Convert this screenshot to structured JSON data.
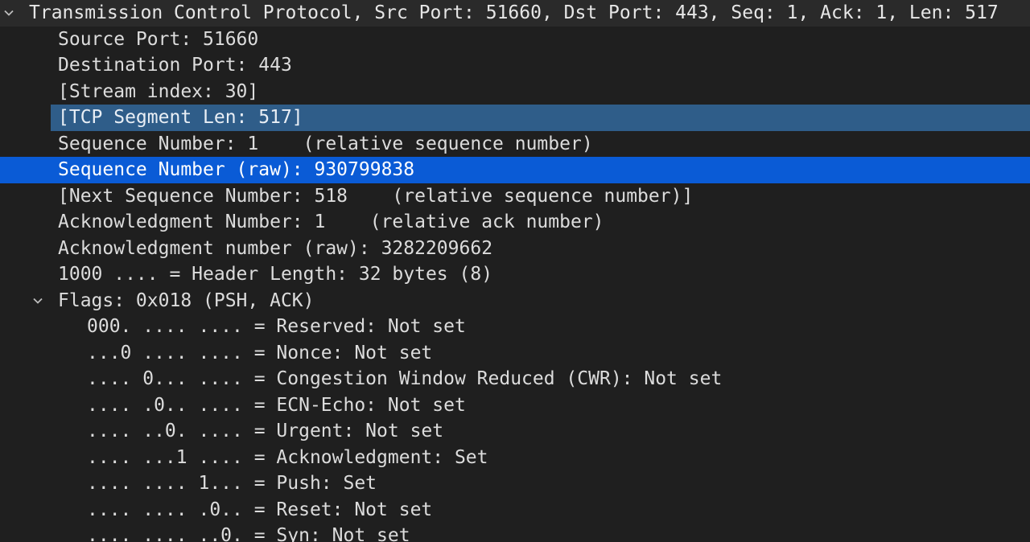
{
  "tree": {
    "header": "Transmission Control Protocol, Src Port: 51660, Dst Port: 443, Seq: 1, Ack: 1, Len: 517",
    "fields": [
      "Source Port: 51660",
      "Destination Port: 443",
      "[Stream index: 30]",
      "[TCP Segment Len: 517]",
      "Sequence Number: 1    (relative sequence number)",
      "Sequence Number (raw): 930799838",
      "[Next Sequence Number: 518    (relative sequence number)]",
      "Acknowledgment Number: 1    (relative ack number)",
      "Acknowledgment number (raw): 3282209662",
      "1000 .... = Header Length: 32 bytes (8)"
    ],
    "flags_label": "Flags: 0x018 (PSH, ACK)",
    "flags": [
      "000. .... .... = Reserved: Not set",
      "...0 .... .... = Nonce: Not set",
      ".... 0... .... = Congestion Window Reduced (CWR): Not set",
      ".... .0.. .... = ECN-Echo: Not set",
      ".... ..0. .... = Urgent: Not set",
      ".... ...1 .... = Acknowledgment: Set",
      ".... .... 1... = Push: Set",
      ".... .... .0.. = Reset: Not set",
      ".... .... ..0. = Syn: Not set"
    ]
  },
  "colors": {
    "background": "#1f1f1f",
    "selected_row": "#0a5bd6",
    "related_field_row": "#2f5d89",
    "text": "#dcdcdc"
  },
  "icons": {
    "expand": "chevron-down-icon"
  }
}
